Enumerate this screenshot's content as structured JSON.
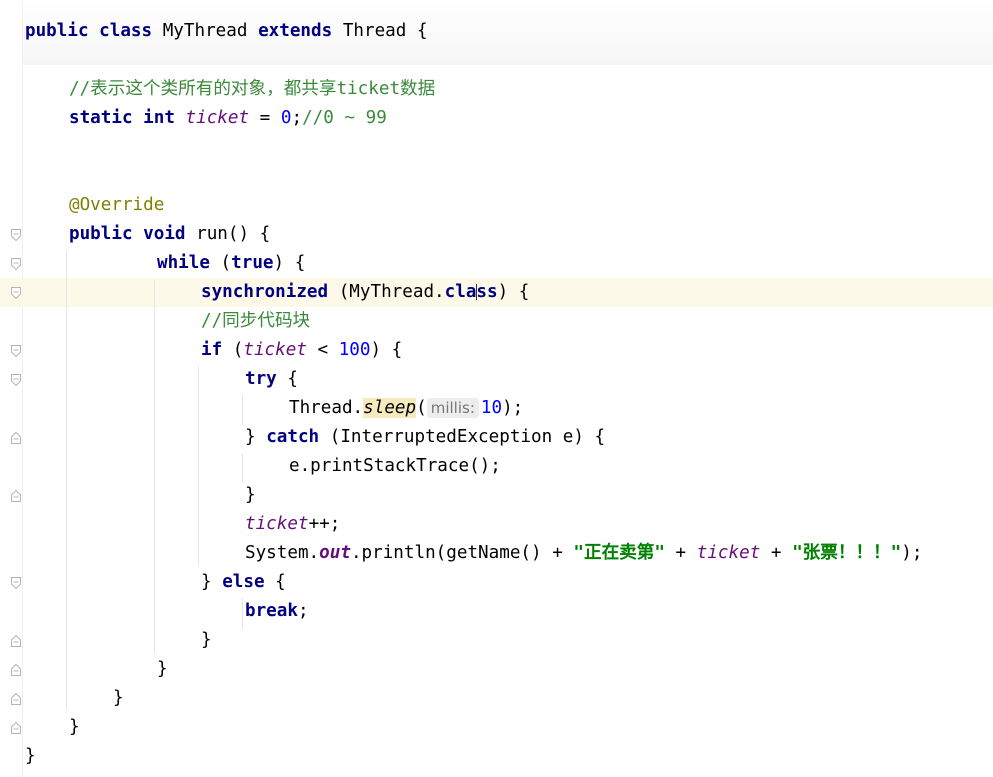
{
  "code": {
    "l1": {
      "kw_public": "public",
      "kw_class": "class",
      "class_name": "MyThread",
      "kw_extends": "extends",
      "super_name": "Thread",
      "brace": "{"
    },
    "l2": {
      "comment": "//表示这个类所有的对象，都共享ticket数据"
    },
    "l3": {
      "kw_static": "static",
      "kw_int": "int",
      "field": "ticket",
      "assign": " = ",
      "value": "0",
      "semi": ";",
      "comment": "//0 ~ 99"
    },
    "l4": {
      "annotation": "@Override"
    },
    "l5": {
      "kw_public": "public",
      "kw_void": "void",
      "method": "run() {"
    },
    "l6": {
      "kw_while": "while",
      "open": " (",
      "kw_true": "true",
      "close": ") {"
    },
    "l7": {
      "kw_synchronized": "synchronized",
      "open": " (MyThread.",
      "kw_class": "class",
      "close": ") {"
    },
    "l8": {
      "comment": "//同步代码块"
    },
    "l9": {
      "kw_if": "if",
      "open": " (",
      "field": "ticket",
      "op": " < ",
      "value": "100",
      "close": ") {"
    },
    "l10": {
      "kw_try": "try",
      "brace": " {"
    },
    "l11": {
      "prefix": "Thread.",
      "method": "sleep",
      "open": "(",
      "hint": "millis:",
      "value": "10",
      "close": ");"
    },
    "l12": {
      "brace": "} ",
      "kw_catch": "catch",
      "rest": " (InterruptedException e) {"
    },
    "l13": {
      "text": "e.printStackTrace();"
    },
    "l14": {
      "text": "}"
    },
    "l15": {
      "field": "ticket",
      "rest": "++;"
    },
    "l16": {
      "prefix": "System.",
      "field": "out",
      "call": ".println(getName() + ",
      "str1": "\"正在卖第\"",
      "plus1": " + ",
      "field2": "ticket",
      "plus2": " + ",
      "str2": "\"张票！！！\"",
      "close": ");"
    },
    "l17": {
      "brace": "} ",
      "kw_else": "else",
      "open": " {"
    },
    "l18": {
      "kw_break": "break",
      "semi": ";"
    },
    "l19": {
      "text": "}"
    },
    "l20": {
      "text": "}"
    },
    "l21": {
      "text": "}"
    },
    "l22": {
      "text": "}"
    },
    "l23": {
      "text": "}"
    }
  },
  "colors": {
    "keyword": "#000080",
    "field": "#660e7a",
    "number": "#0000ff",
    "string": "#008000",
    "annotation": "#808000",
    "comment": "#808080",
    "current_line": "#fcf9e8"
  }
}
